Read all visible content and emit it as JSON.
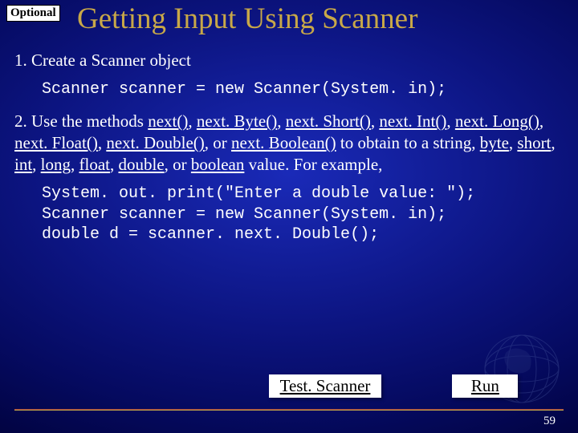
{
  "badge": "Optional",
  "title": "Getting Input Using Scanner",
  "step1_label": "1. Create a Scanner object",
  "code1": "Scanner scanner = new Scanner(System. in);",
  "step2_prefix": "2. Use the methods ",
  "methods": [
    "next()",
    "next. Byte()",
    "next. Short()",
    "next. Int()",
    "next. Long()",
    "next. Float()",
    "next. Double()",
    "next. Boolean()"
  ],
  "step2_mid": " to obtain to a string, ",
  "types": [
    "byte",
    "short",
    "int",
    "long",
    "float",
    "double"
  ],
  "step2_or": ", or ",
  "type_last": "boolean",
  "step2_suffix": " value. For example,",
  "code2_l1": "System. out. print(\"Enter a double value: \");",
  "code2_l2": "Scanner scanner = new Scanner(System. in);",
  "code2_l3": "double d = scanner. next. Double();",
  "btn_test": "Test. Scanner",
  "btn_run": "Run",
  "page": "59"
}
